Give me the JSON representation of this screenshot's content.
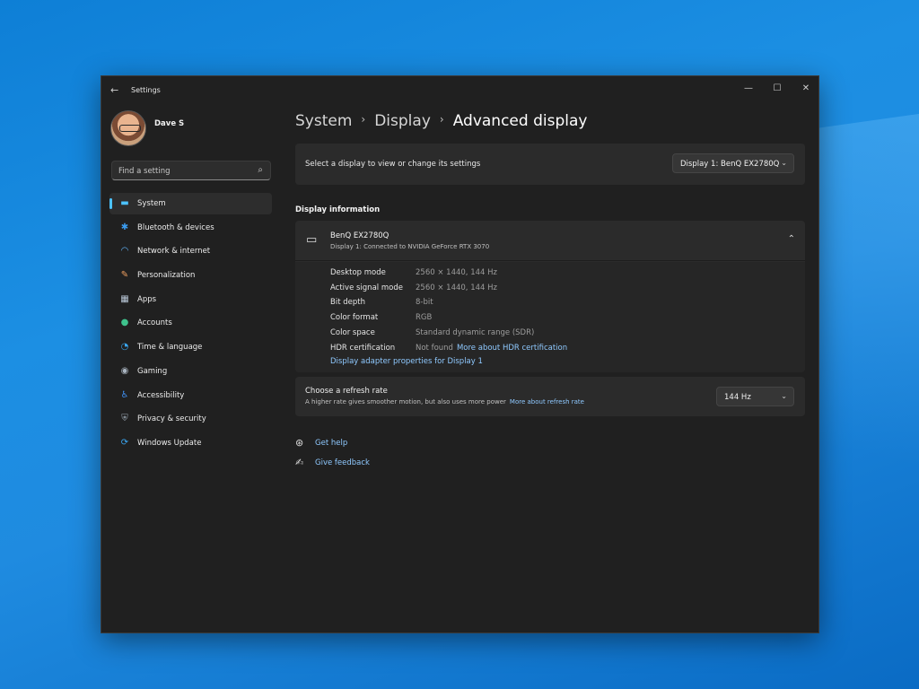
{
  "titlebar": {
    "back_glyph": "←",
    "app_title": "Settings",
    "minimize_glyph": "—",
    "maximize_glyph": "☐",
    "close_glyph": "✕"
  },
  "profile": {
    "name": "Dave S"
  },
  "search": {
    "placeholder": "Find a setting",
    "icon": "⌕"
  },
  "sidebar": {
    "items": [
      {
        "label": "System",
        "icon": "monitor-icon",
        "glyph": "▬",
        "color": "#4cc2ff",
        "active": true
      },
      {
        "label": "Bluetooth & devices",
        "icon": "bluetooth-icon",
        "glyph": "✱",
        "color": "#3b9cf0"
      },
      {
        "label": "Network & internet",
        "icon": "wifi-icon",
        "glyph": "◠",
        "color": "#62b8ff"
      },
      {
        "label": "Personalization",
        "icon": "brush-icon",
        "glyph": "✎",
        "color": "#f0a060"
      },
      {
        "label": "Apps",
        "icon": "apps-icon",
        "glyph": "▦",
        "color": "#b8c6d6"
      },
      {
        "label": "Accounts",
        "icon": "person-icon",
        "glyph": "●",
        "color": "#3ec28c"
      },
      {
        "label": "Time & language",
        "icon": "globe-clock-icon",
        "glyph": "◔",
        "color": "#3aa6f0"
      },
      {
        "label": "Gaming",
        "icon": "gamepad-icon",
        "glyph": "◉",
        "color": "#a9b4c0"
      },
      {
        "label": "Accessibility",
        "icon": "accessibility-icon",
        "glyph": "♿",
        "color": "#3f8ff0"
      },
      {
        "label": "Privacy & security",
        "icon": "shield-icon",
        "glyph": "⛨",
        "color": "#9aa6b2"
      },
      {
        "label": "Windows Update",
        "icon": "update-icon",
        "glyph": "⟳",
        "color": "#3aa6f0"
      }
    ]
  },
  "breadcrumb": {
    "items": [
      "System",
      "Display"
    ],
    "separator": "›",
    "current": "Advanced display"
  },
  "display_select": {
    "label": "Select a display to view or change its settings",
    "value": "Display 1: BenQ EX2780Q",
    "chevron": "⌄"
  },
  "display_info": {
    "section_title": "Display information",
    "name": "BenQ EX2780Q",
    "subtitle": "Display 1: Connected to NVIDIA GeForce RTX 3070",
    "collapse_glyph": "⌃",
    "monitor_glyph": "▭",
    "specs": [
      {
        "label": "Desktop mode",
        "value": "2560 × 1440, 144 Hz"
      },
      {
        "label": "Active signal mode",
        "value": "2560 × 1440, 144 Hz"
      },
      {
        "label": "Bit depth",
        "value": "8-bit"
      },
      {
        "label": "Color format",
        "value": "RGB"
      },
      {
        "label": "Color space",
        "value": "Standard dynamic range (SDR)"
      },
      {
        "label": "HDR certification",
        "value": "Not found",
        "link": "More about HDR certification"
      }
    ],
    "adapter_link": "Display adapter properties for Display 1"
  },
  "refresh_rate": {
    "title": "Choose a refresh rate",
    "description": "A higher rate gives smoother motion, but also uses more power",
    "link": "More about refresh rate",
    "value": "144 Hz",
    "chevron": "⌄"
  },
  "help": {
    "get_help": "Get help",
    "get_help_glyph": "⊛",
    "give_feedback": "Give feedback",
    "give_feedback_glyph": "✍"
  },
  "colors": {
    "accent": "#4cc2ff",
    "link": "#8fc9ff",
    "window_bg": "#202020",
    "card_bg": "#2b2b2b"
  }
}
